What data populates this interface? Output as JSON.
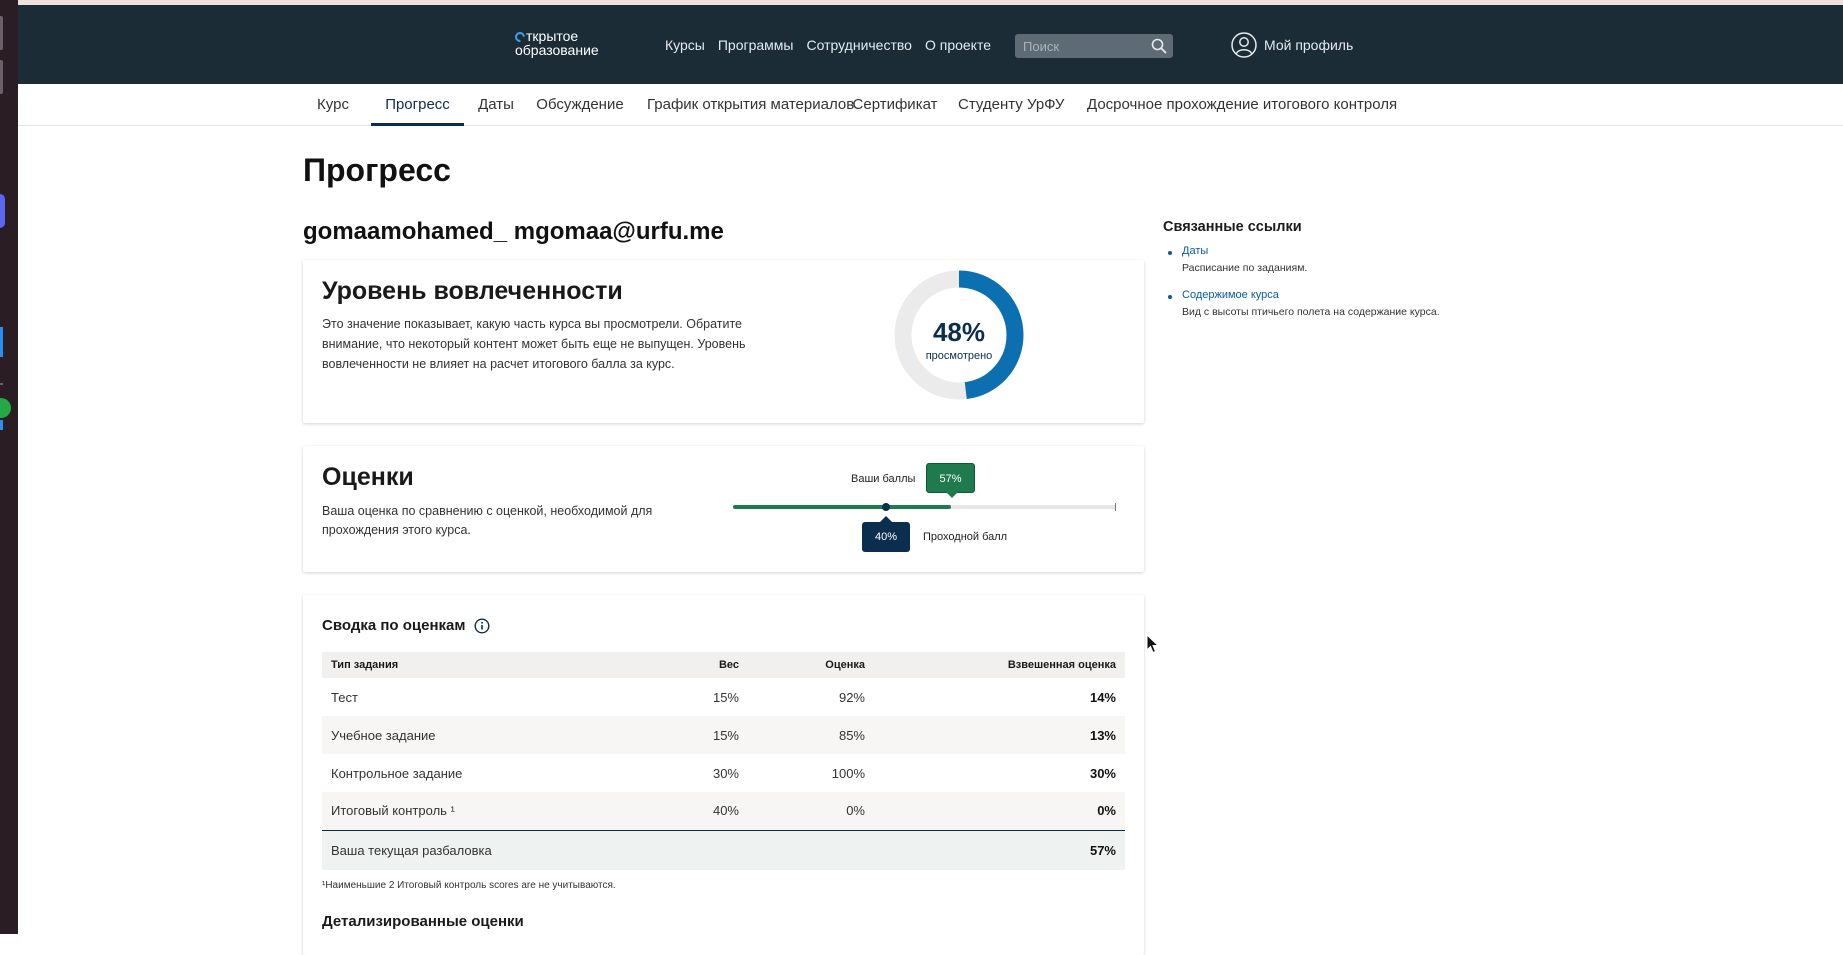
{
  "header": {
    "logo_line1": "ткрытое",
    "logo_line2": "образование",
    "nav": [
      "Курсы",
      "Программы",
      "Сотрудничество",
      "О проекте"
    ],
    "search_placeholder": "Поиск",
    "profile_label": "Мой профиль"
  },
  "tabs": [
    "Курс",
    "Прогресс",
    "Даты",
    "Обсуждение",
    "График открытия материалов",
    "Сертификат",
    "Студенту УрФУ",
    "Досрочное прохождение итогового контроля"
  ],
  "active_tab": "Прогресс",
  "page_title": "Прогресс",
  "user_line": "gomaamohamed_ mgomaa@urfu.me",
  "engagement": {
    "title": "Уровень вовлеченности",
    "text": "Это значение показывает, какую часть курса вы просмотрели. Обратите внимание, что некоторый контент может быть еще не выпущен. Уровень вовлеченности не влияет на расчет итогового балла за курс.",
    "percent": 48,
    "percent_label": "48%",
    "sub_label": "просмотрено",
    "color_done": "#0b6fb0",
    "color_rest": "#ebebeb"
  },
  "grades": {
    "title": "Оценки",
    "text": "Ваша оценка по сравнению с оценкой, необходимой для прохождения этого курса.",
    "your_label": "Ваши баллы",
    "your_value": 57,
    "your_value_label": "57%",
    "pass_label": "Проходной балл",
    "pass_value": 40,
    "pass_value_label": "40%",
    "color_your": "#1f7a4d",
    "color_pass": "#0b2e4f"
  },
  "summary": {
    "title": "Сводка по оценкам",
    "headers": [
      "Тип задания",
      "Вес",
      "Оценка",
      "Взвешенная оценка"
    ],
    "rows": [
      [
        "Тест",
        "15%",
        "92%",
        "14%"
      ],
      [
        "Учебное задание",
        "15%",
        "85%",
        "13%"
      ],
      [
        "Контрольное задание",
        "30%",
        "100%",
        "30%"
      ],
      [
        "Итоговый контроль ¹",
        "40%",
        "0%",
        "0%"
      ]
    ],
    "total_label": "Ваша текущая разбаловка",
    "total_value": "57%",
    "footnote": "¹Наименьшие 2 Итоговый контроль scores are не учитываются.",
    "detailed_title": "Детализированные оценки"
  },
  "related": {
    "title": "Связанные ссылки",
    "links": [
      {
        "label": "Даты",
        "desc": "Расписание по заданиям."
      },
      {
        "label": "Содержимое курса",
        "desc": "Вид с высоты птичьего полета на содержание курса."
      }
    ]
  }
}
